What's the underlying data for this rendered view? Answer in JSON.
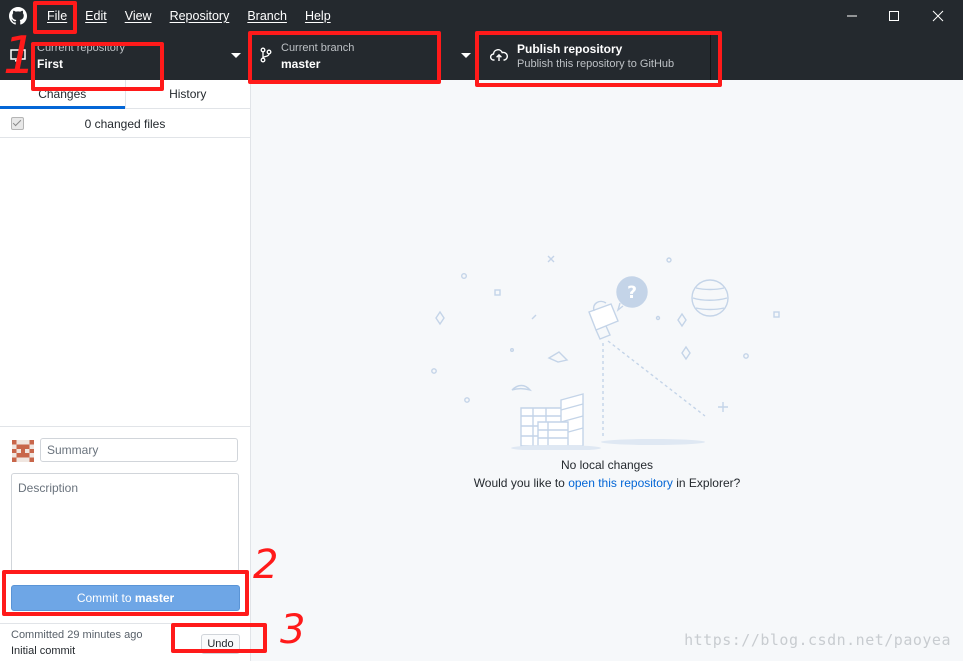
{
  "menu": [
    "File",
    "Edit",
    "View",
    "Repository",
    "Branch",
    "Help"
  ],
  "toolbar": {
    "repo_label": "Current repository",
    "repo_name": "First",
    "branch_label": "Current branch",
    "branch_name": "master",
    "publish_title": "Publish repository",
    "publish_sub": "Publish this repository to GitHub"
  },
  "sidebar": {
    "tabs": [
      "Changes",
      "History"
    ],
    "changed_files": "0 changed files",
    "summary_placeholder": "Summary",
    "description_placeholder": "Description",
    "commit_prefix": "Commit to ",
    "commit_branch": "master",
    "last_commit_time": "Committed 29 minutes ago",
    "last_commit_message": "Initial commit",
    "undo_label": "Undo"
  },
  "main": {
    "blank_title": "No local changes",
    "blank_sub_pre": "Would you like to ",
    "blank_sub_link": "open this repository",
    "blank_sub_post": " in Explorer?"
  },
  "annotations": [
    "1",
    "2",
    "3"
  ],
  "watermark": "https://blog.csdn.net/paoyea",
  "colors": {
    "toolbar_bg": "#24292e",
    "accent_blue": "#0366d6",
    "commit_button": "#6ea6e6",
    "annotation_red": "#ff1a1a"
  },
  "icons": [
    "github-logo-icon",
    "minimize-icon",
    "maximize-icon",
    "close-icon",
    "monitor-icon",
    "branch-icon",
    "cloud-upload-icon",
    "caret-down-icon"
  ]
}
